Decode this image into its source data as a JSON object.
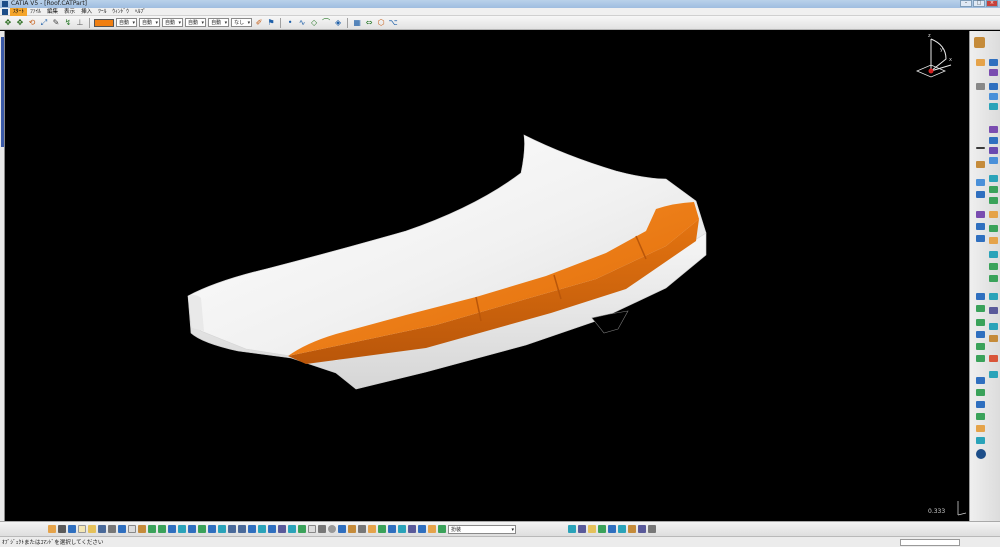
{
  "window": {
    "title": "CATIA V5 - [Roof.CATPart]",
    "controls": {
      "minimize": "–",
      "maximize": "□",
      "close": "×"
    }
  },
  "menubar": {
    "items": [
      {
        "label": "ｽﾀｰﾄ",
        "active": true
      },
      {
        "label": "ﾌｧｲﾙ",
        "active": false
      },
      {
        "label": "編集",
        "active": false
      },
      {
        "label": "表示",
        "active": false
      },
      {
        "label": "挿入",
        "active": false
      },
      {
        "label": "ﾂｰﾙ",
        "active": false
      },
      {
        "label": "ｳｨﾝﾄﾞｳ",
        "active": false
      },
      {
        "label": "ﾍﾙﾌﾟ",
        "active": false
      }
    ]
  },
  "toolbar": {
    "color_swatch": "#f07f12",
    "combos": [
      "自動",
      "自動",
      "自動",
      "自動",
      "自動",
      "なし"
    ]
  },
  "viewport": {
    "background": "#000000",
    "body_color": "#f2f2f2",
    "spoiler_color": "#f07f12",
    "zoom_value": "0.333",
    "compass_labels": {
      "z": "z",
      "y": "y",
      "x": "x"
    }
  },
  "bottom_toolbar": {
    "combo_value": "扮装"
  },
  "statusbar": {
    "text": "ｵﾌﾞｼﾞｪｸﾄまたはｺﾏﾝﾄﾞを選択してください"
  }
}
